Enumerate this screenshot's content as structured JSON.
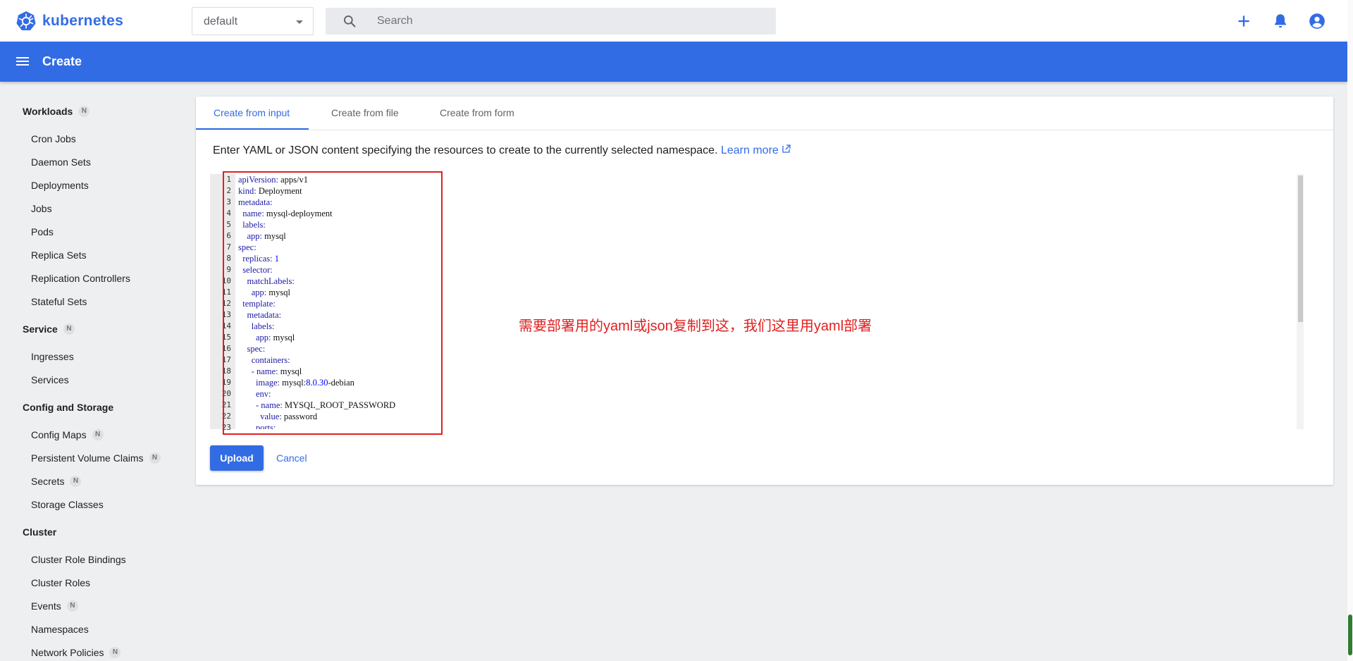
{
  "app": {
    "name": "kubernetes",
    "brand_color": "#326ce5"
  },
  "namespace": {
    "selected": "default"
  },
  "search": {
    "placeholder": "Search"
  },
  "topbar_icons": [
    "add-icon",
    "notifications-icon",
    "account-icon"
  ],
  "appbar": {
    "title": "Create"
  },
  "sidebar": {
    "sections": [
      {
        "label": "Workloads",
        "badge": "N",
        "items": [
          {
            "label": "Cron Jobs"
          },
          {
            "label": "Daemon Sets"
          },
          {
            "label": "Deployments"
          },
          {
            "label": "Jobs"
          },
          {
            "label": "Pods"
          },
          {
            "label": "Replica Sets"
          },
          {
            "label": "Replication Controllers"
          },
          {
            "label": "Stateful Sets"
          }
        ]
      },
      {
        "label": "Service",
        "badge": "N",
        "items": [
          {
            "label": "Ingresses"
          },
          {
            "label": "Services"
          }
        ]
      },
      {
        "label": "Config and Storage",
        "badge": "",
        "items": [
          {
            "label": "Config Maps",
            "badge": "N"
          },
          {
            "label": "Persistent Volume Claims",
            "badge": "N"
          },
          {
            "label": "Secrets",
            "badge": "N"
          },
          {
            "label": "Storage Classes"
          }
        ]
      },
      {
        "label": "Cluster",
        "badge": "",
        "items": [
          {
            "label": "Cluster Role Bindings"
          },
          {
            "label": "Cluster Roles"
          },
          {
            "label": "Events",
            "badge": "N"
          },
          {
            "label": "Namespaces"
          },
          {
            "label": "Network Policies",
            "badge": "N"
          }
        ]
      }
    ]
  },
  "tabs": [
    {
      "label": "Create from input",
      "active": true
    },
    {
      "label": "Create from file"
    },
    {
      "label": "Create from form"
    }
  ],
  "description": {
    "text": "Enter YAML or JSON content specifying the resources to create to the currently selected namespace.",
    "link": "Learn more"
  },
  "editor": {
    "lines": [
      "apiVersion: apps/v1",
      "kind: Deployment",
      "metadata:",
      "  name: mysql-deployment",
      "  labels:",
      "    app: mysql",
      "spec:",
      "  replicas: 1",
      "  selector:",
      "    matchLabels:",
      "      app: mysql",
      "  template:",
      "    metadata:",
      "      labels:",
      "        app: mysql",
      "    spec:",
      "      containers:",
      "      - name: mysql",
      "        image: mysql:8.0.30-debian",
      "        env:",
      "        - name: MYSQL_ROOT_PASSWORD",
      "          value: password",
      "        ports:"
    ]
  },
  "annotation": {
    "text": "需要部署用的yaml或json复制到这，我们这里用yaml部署",
    "color": "#e02020"
  },
  "buttons": {
    "upload": "Upload",
    "cancel": "Cancel"
  }
}
